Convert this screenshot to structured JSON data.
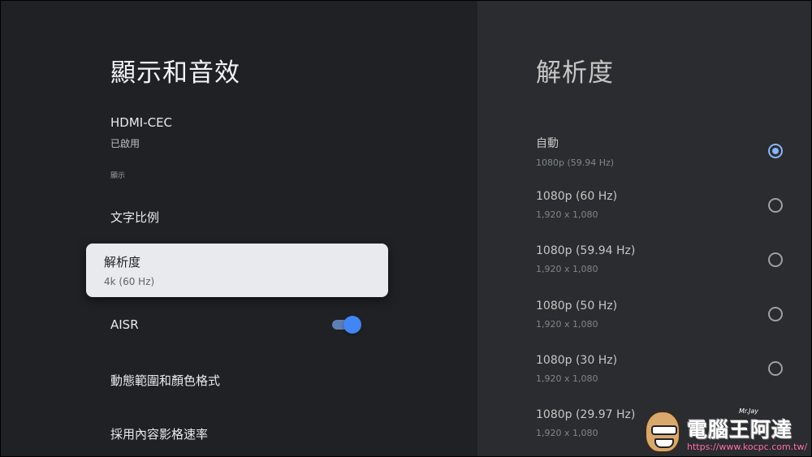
{
  "left_panel": {
    "title": "顯示和音效",
    "hdmi": {
      "title": "HDMI-CEC",
      "subtitle": "已啟用"
    },
    "section_label": "顯示",
    "items": {
      "text_scale": "文字比例",
      "resolution": {
        "title": "解析度",
        "subtitle": "4k (60 Hz)"
      },
      "aisr": {
        "title": "AISR",
        "toggle_on": true
      },
      "dynamic_range": "動態範圍和顏色格式",
      "match_frame_rate": "採用內容影格速率"
    }
  },
  "right_panel": {
    "title": "解析度",
    "options": [
      {
        "title": "自動",
        "subtitle": "1080p (59.94 Hz)",
        "selected": true
      },
      {
        "title": "1080p (60 Hz)",
        "subtitle": "1,920 x 1,080",
        "selected": false
      },
      {
        "title": "1080p (59.94 Hz)",
        "subtitle": "1,920 x 1,080",
        "selected": false
      },
      {
        "title": "1080p (50 Hz)",
        "subtitle": "1,920 x 1,080",
        "selected": false
      },
      {
        "title": "1080p (30 Hz)",
        "subtitle": "1,920 x 1,080",
        "selected": false
      },
      {
        "title": "1080p (29.97 Hz)",
        "subtitle": "1,920 x 1,080",
        "selected": false
      }
    ]
  },
  "watermark": {
    "brand": "電腦王阿達",
    "url": "https://www.kocpc.com.tw/",
    "signature": "Mr.Jay"
  },
  "colors": {
    "accent": "#8ab4f8",
    "toggle": "#4285f4",
    "left_bg": "#202124",
    "right_bg": "#2a2c2f",
    "card": "#e8eaed"
  }
}
